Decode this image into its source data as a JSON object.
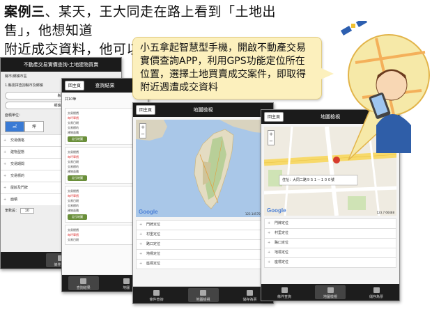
{
  "headline": {
    "bold": "案例三",
    "rest_line1": "、某天，王大同走在路上看到「土地出售」，他想知道",
    "line2": "附近成交資料，他可以這樣做..."
  },
  "callout": {
    "text": "小五拿起智慧型手機，開啟不動產交易實價查詢APP，利用GPS功能定位所在位置，選擇土地買賣成交案件，即取得附近週遭成交資料"
  },
  "screen1": {
    "title": "不動產交易實價查詢-土地建物買賣",
    "section": "縣市/鄉鎮市區",
    "hint": "1.縣需擇查詢縣市及鄉鎮",
    "county_button": "縣市",
    "district_button": "鄉鎮市區",
    "unit_label": "面積單位：",
    "units": [
      "㎡",
      "坪"
    ],
    "rows": [
      "交易價格",
      "建物型態",
      "交易期間",
      "交易標的",
      "屋齡及門牌",
      "面積"
    ],
    "count_label": "筆數設：",
    "count_value": "10",
    "footer_tab": "條件查詢"
  },
  "screen2": {
    "home": "回主頁",
    "title": "查詢結果",
    "result_count": "共10筆",
    "cards": [
      {
        "lines": [
          "交易總價",
          "每坪單價",
          "交易日期",
          "交易標的",
          "建物面積"
        ],
        "map": "定位地圖"
      },
      {
        "lines": [
          "交易總價",
          "每坪單價",
          "交易日期",
          "交易標的",
          "建物面積"
        ],
        "map": "定位地圖"
      },
      {
        "lines": [
          "交易總價",
          "每坪單價",
          "交易日期",
          "交易標的",
          "建物面積"
        ],
        "map": "定位地圖"
      },
      {
        "lines": [
          "交易總價",
          "每坪單價",
          "交易日期"
        ],
        "map": ""
      }
    ],
    "tabs": [
      "查詢結果",
      "地圖"
    ]
  },
  "screen3": {
    "home": "回主頁",
    "title": "地圖檢視",
    "scale": "123.14570, 24.6",
    "list": [
      "門牌定位",
      "村里定位",
      "路口定位",
      "地標定位",
      "座標定位"
    ],
    "tabs": [
      "條件查詢",
      "地圖檢視",
      "儲存為票"
    ]
  },
  "screen4": {
    "home": "回主頁",
    "title": "地圖檢視",
    "address": "住址：大同二路９５１－１００號",
    "scale": "123.7 66488",
    "list": [
      "門牌定位",
      "村里定位",
      "路口定位",
      "地標定位",
      "座標定位"
    ],
    "tabs": [
      "條件查詢",
      "地圖檢視",
      "儲存為票"
    ]
  },
  "google_label": "Google",
  "colors": {
    "callout_bg": "#fcf0bd",
    "topbar": "#1b1b1b",
    "accent_blue": "#3a7bd5",
    "price_red": "#d33333"
  }
}
